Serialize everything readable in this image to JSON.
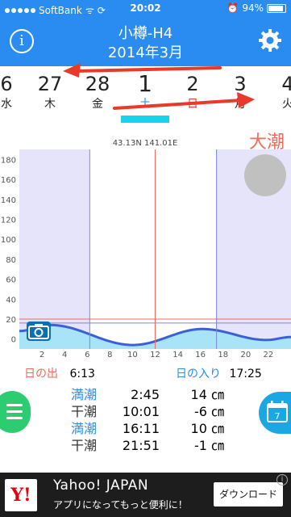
{
  "status": {
    "carrier": "SoftBank",
    "time": "20:02",
    "battery": "94%"
  },
  "header": {
    "title": "小樽-H4",
    "subtitle": "2014年3月",
    "info_icon": "info-icon",
    "settings_icon": "gear-icon",
    "bg_color": "#2a8cf0"
  },
  "dates": [
    {
      "num": "6",
      "day": "水",
      "color": "#222"
    },
    {
      "num": "27",
      "day": "木",
      "color": "#222"
    },
    {
      "num": "28",
      "day": "金",
      "color": "#222"
    },
    {
      "num": "1",
      "day": "土",
      "color": "#2a8cf0"
    },
    {
      "num": "2",
      "day": "日",
      "color": "#e8392b"
    },
    {
      "num": "3",
      "day": "月",
      "color": "#222"
    },
    {
      "num": "4",
      "day": "火",
      "color": "#222"
    }
  ],
  "tide_name": "大潮",
  "coordinates": "43.13N 141.01E",
  "chart_data": {
    "type": "area",
    "y_ticks": [
      "180",
      "160",
      "140",
      "120",
      "100",
      "80",
      "60",
      "40",
      "20",
      "0"
    ],
    "x_ticks": [
      "2",
      "4",
      "6",
      "8",
      "10",
      "12",
      "14",
      "16",
      "18",
      "20",
      "22"
    ],
    "ylim": [
      -10,
      190
    ],
    "xlim": [
      0,
      24
    ],
    "tide_curve": [
      {
        "x": 0,
        "y": 8
      },
      {
        "x": 2.75,
        "y": 14
      },
      {
        "x": 10.02,
        "y": -6
      },
      {
        "x": 16.18,
        "y": 10
      },
      {
        "x": 21.85,
        "y": -1
      },
      {
        "x": 24,
        "y": 2
      }
    ],
    "ref_lines": [
      20,
      16
    ],
    "sunrise_x": 6.22,
    "sunset_x": 17.42,
    "now_x": 12
  },
  "sun": {
    "rise_label": "日の出",
    "rise_time": "6:13",
    "set_label": "日の入り",
    "set_time": "17:25"
  },
  "tides": [
    {
      "type": "満潮",
      "type_color": "#2a8cf0",
      "time": "2:45",
      "height": "14 ㎝"
    },
    {
      "type": "干潮",
      "type_color": "#333333",
      "time": "10:01",
      "height": "-6 ㎝"
    },
    {
      "type": "満潮",
      "type_color": "#2a8cf0",
      "time": "16:11",
      "height": "10 ㎝"
    },
    {
      "type": "干潮",
      "type_color": "#333333",
      "time": "21:51",
      "height": "-1 ㎝"
    }
  ],
  "ad": {
    "brand": "Y!",
    "name": "Yahoo! JAPAN",
    "desc": "アプリになってもっと便利に！",
    "button": "ダウンロード",
    "info": "i"
  },
  "calendar_day": "7"
}
